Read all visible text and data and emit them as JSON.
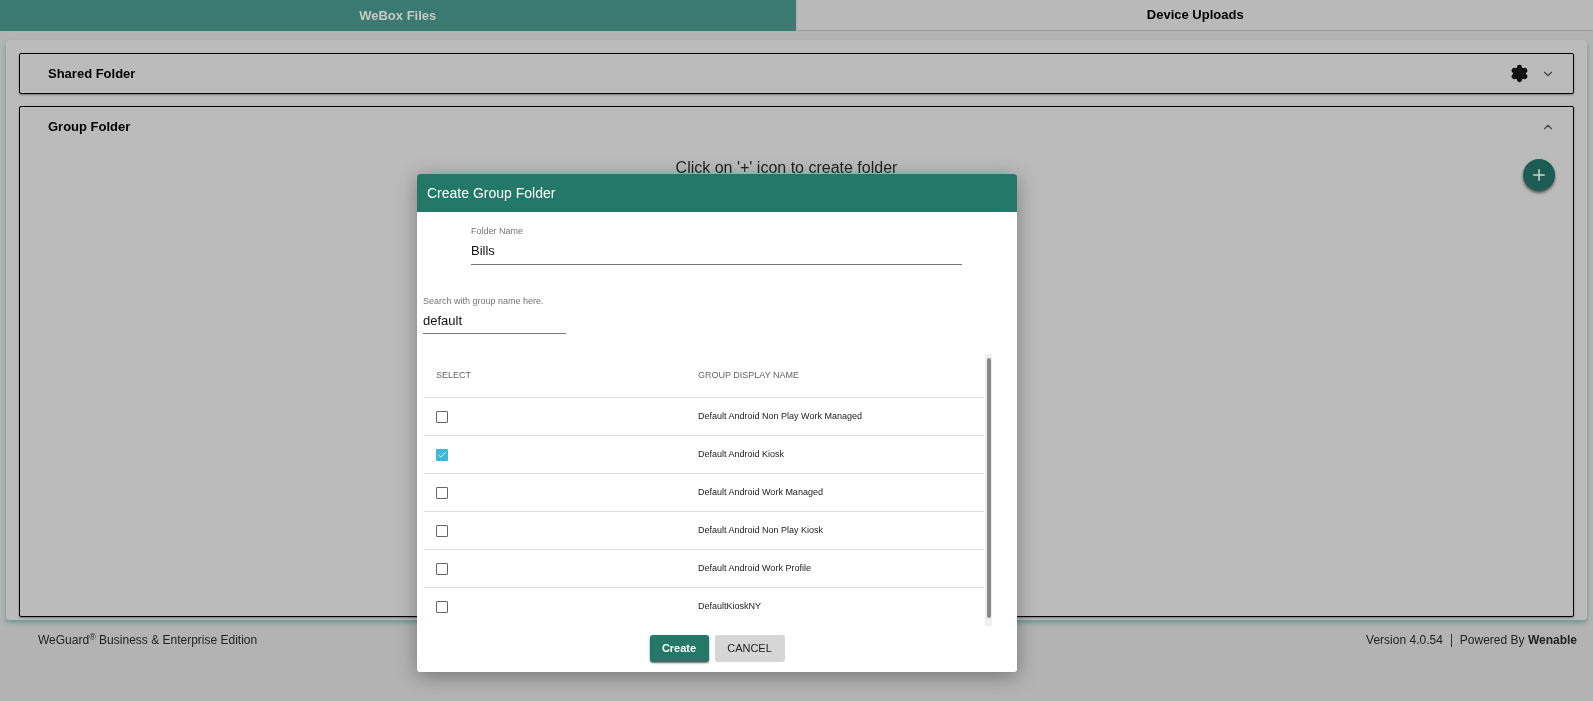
{
  "tabs": [
    {
      "label": "WeBox Files",
      "selected": true
    },
    {
      "label": "Device Uploads",
      "selected": false
    }
  ],
  "panels": [
    {
      "title": "Shared Folder",
      "expanded": false,
      "settings_button": true
    },
    {
      "title": "Group Folder",
      "expanded": true,
      "settings_button": false,
      "empty_message": "Click on '+' icon to create folder"
    }
  ],
  "dialog": {
    "title": "Create Group Folder",
    "folder_name": {
      "label": "Folder Name",
      "value": "Bills"
    },
    "search": {
      "label": "Search with group name here.",
      "value": "default"
    },
    "table": {
      "columns": [
        "SELECT",
        "GROUP DISPLAY NAME"
      ],
      "rows": [
        {
          "name": "Default Android Non Play Work Managed",
          "checked": false
        },
        {
          "name": "Default Android Kiosk",
          "checked": true
        },
        {
          "name": "Default Android Work Managed",
          "checked": false
        },
        {
          "name": "Default Android Non Play Kiosk",
          "checked": false
        },
        {
          "name": "Default Android Work Profile",
          "checked": false
        },
        {
          "name": "DefaultKioskNY",
          "checked": false
        }
      ]
    },
    "buttons": [
      {
        "label": "Create",
        "kind": "primary"
      },
      {
        "label": "CANCEL",
        "kind": "secondary"
      }
    ]
  },
  "footer": {
    "edition": "WeGuard$^{®}$ Business & Enterprise Edition",
    "version": "Version 4.0.54",
    "powered_by": "Powered By **Wenable**"
  }
}
